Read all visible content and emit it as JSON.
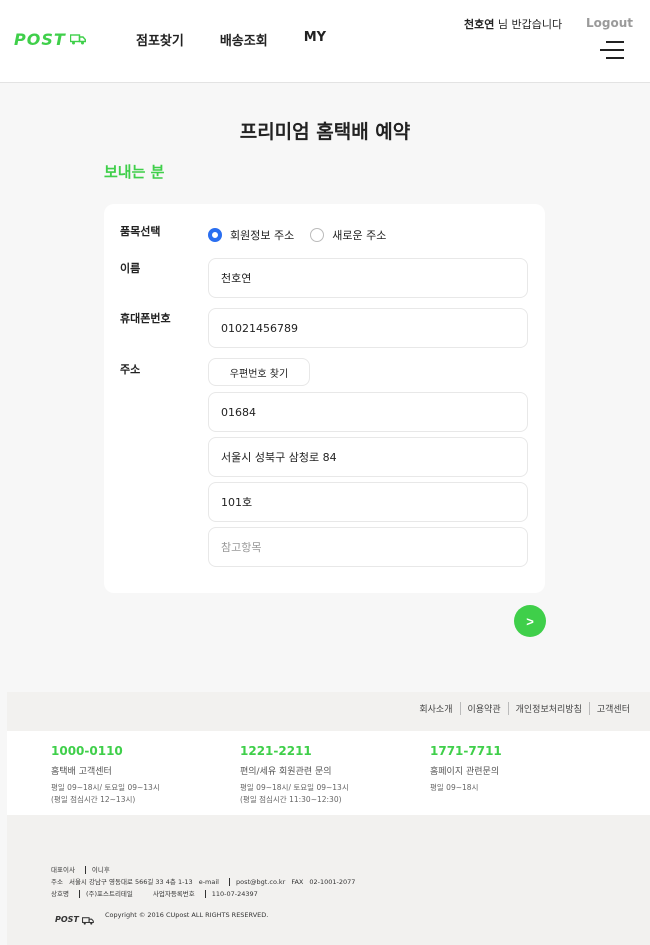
{
  "header": {
    "logo_text": "POST",
    "nav": [
      "점포찾기",
      "배송조회",
      "MY"
    ],
    "user_name": "천호연",
    "greeting_suffix": " 님 반갑습니다",
    "logout": "Logout"
  },
  "main": {
    "page_title": "프리미엄 홈택배 예약",
    "section_title": "보내는 분",
    "form": {
      "item_label": "품목선택",
      "radio_options": [
        "회원정보 주소",
        "새로운 주소"
      ],
      "radio_selected": "회원정보 주소",
      "name_label": "이름",
      "name_value": "천호연",
      "phone_label": "휴대폰번호",
      "phone_value": "01021456789",
      "address_label": "주소",
      "zip_button": "우편번호 찾기",
      "zip_value": "01684",
      "address_value": "서울시 성북구 삼청로 84",
      "detail_value": "101호",
      "memo_placeholder": "참고항목"
    },
    "next_button": ">"
  },
  "footer": {
    "links": [
      "회사소개",
      "이용약관",
      "개인정보처리방침",
      "고객센터"
    ],
    "contacts": [
      {
        "number": "1000-0110",
        "name": "홈택배 고객센터",
        "hours": [
          "평일 09~18시/ 토요일 09~13시",
          "(평일 점심시간 12~13시)"
        ]
      },
      {
        "number": "1221-2211",
        "name": "편의/세유 회원관련 문의",
        "hours": [
          "평일 09~18시/ 토요일 09~13시",
          "(평일 점심시간 11:30~12:30)"
        ]
      },
      {
        "number": "1771-7711",
        "name": "홈페이지 관련문의",
        "hours": [
          "평일 09~18시"
        ]
      }
    ],
    "company": {
      "ceo_label": "대표이사",
      "ceo_value": "이니후",
      "address_label": "주소",
      "address_value": "서울시 강남구 영동대로 566길 33 4층 1-13",
      "email_label": "e-mail",
      "email_value": "post@bgt.co.kr",
      "fax_label": "FAX",
      "fax_value": "02-1001-2077",
      "name_label": "상호명",
      "name_value": "(주)포스트리테일",
      "biz_label": "사업자등록번호",
      "biz_value": "110-07-24397"
    },
    "copyright": "Copyright © 2016 CUpost ALL RIGHTS RESERVED."
  },
  "colors": {
    "brand_green": "#3fcf4a",
    "radio_blue": "#2a6ef0"
  }
}
